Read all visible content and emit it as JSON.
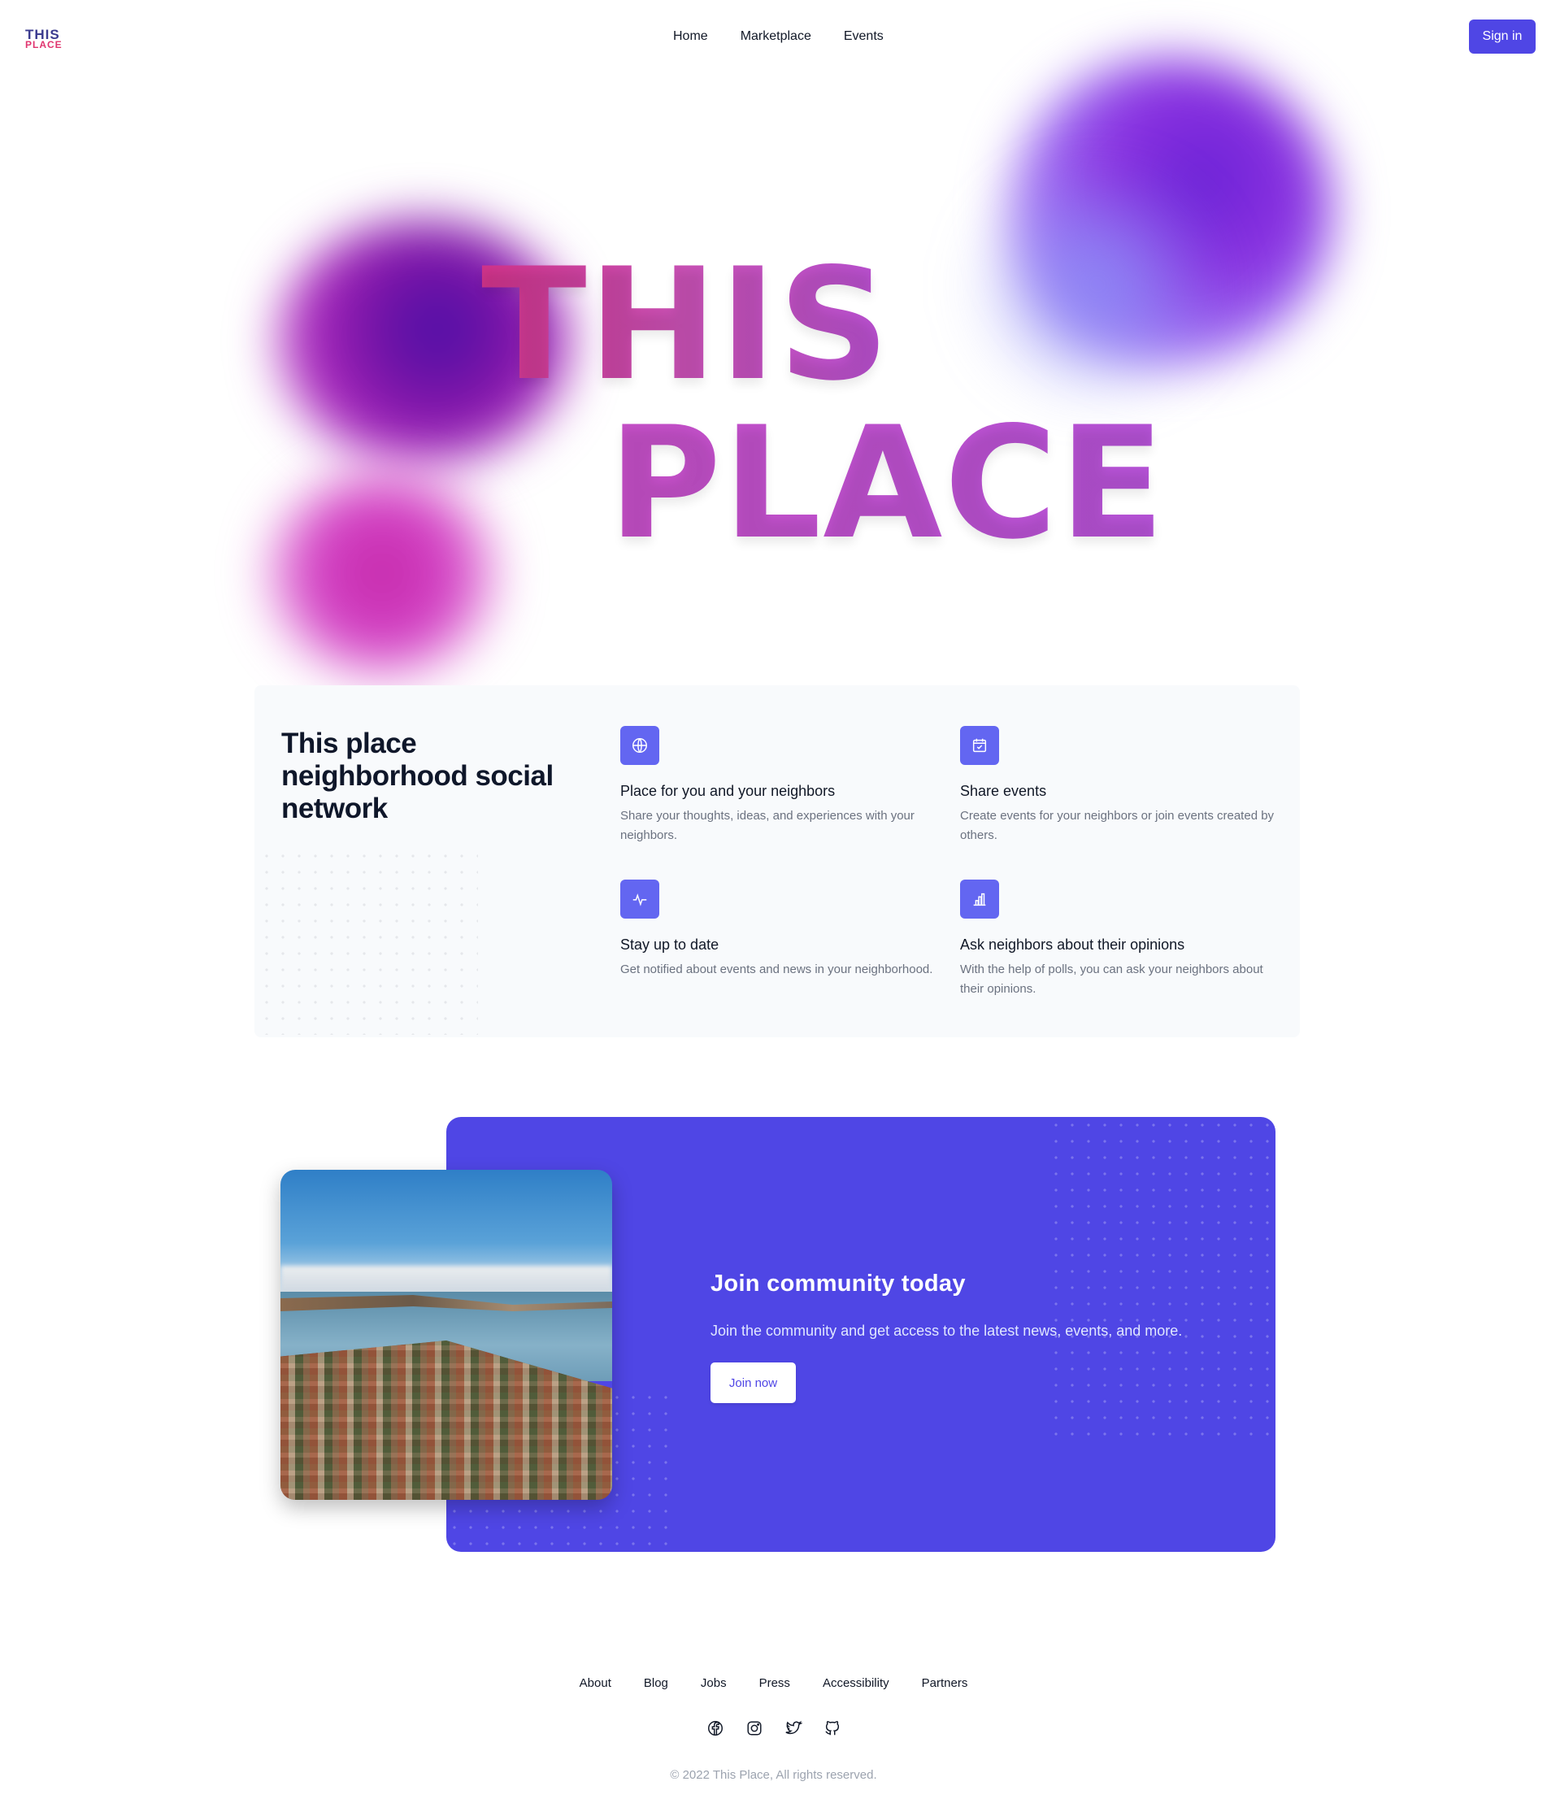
{
  "header": {
    "logo_line1": "THIS",
    "logo_line2": "PLACE",
    "nav": [
      "Home",
      "Marketplace",
      "Events"
    ],
    "signin_label": "Sign in"
  },
  "hero": {
    "line1": "THIS",
    "line2": "PLACE",
    "colors": {
      "pink": "#d0338a",
      "magenta": "#c851b5",
      "purple": "#b64fcf"
    }
  },
  "features": {
    "title": "This place neighborhood social network",
    "items": [
      {
        "icon": "globe-icon",
        "title": "Place for you and your neighbors",
        "text": "Share your thoughts, ideas, and experiences with your neighbors."
      },
      {
        "icon": "calendar-check-icon",
        "title": "Share events",
        "text": "Create events for your neighbors or join events created by others."
      },
      {
        "icon": "activity-icon",
        "title": "Stay up to date",
        "text": "Get notified about events and news in your neighborhood."
      },
      {
        "icon": "bar-chart-icon",
        "title": "Ask neighbors about their opinions",
        "text": "With the help of polls, you can ask your neighbors about their opinions."
      }
    ]
  },
  "cta": {
    "title": "Join community today",
    "text": "Join the community and get access to the latest news, events, and more.",
    "button": "Join now",
    "accent": "#4f46e5"
  },
  "footer": {
    "links": [
      "About",
      "Blog",
      "Jobs",
      "Press",
      "Accessibility",
      "Partners"
    ],
    "social": [
      "facebook-icon",
      "instagram-icon",
      "twitter-icon",
      "github-icon"
    ],
    "copyright": "© 2022 This Place, All rights reserved."
  }
}
